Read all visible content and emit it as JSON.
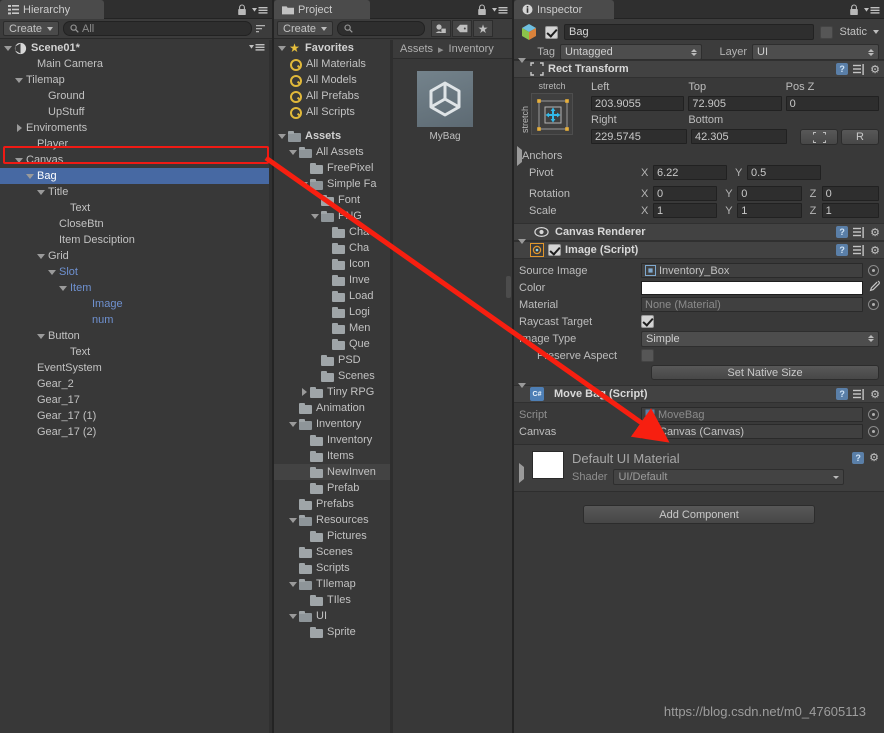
{
  "hierarchy": {
    "tab_label": "Hierarchy",
    "tab_icon": "hierarchy-icon",
    "lock_icon": "lock-icon",
    "menu_icon": "panel-menu-icon",
    "create_label": "Create",
    "search_placeholder": "All",
    "search_value": "All",
    "scene_name": "Scene01*",
    "items": [
      {
        "label": "Main Camera",
        "indent": 2,
        "arrow": "none",
        "style": "normal"
      },
      {
        "label": "Tilemap",
        "indent": 1,
        "arrow": "down",
        "style": "normal"
      },
      {
        "label": "Ground",
        "indent": 3,
        "arrow": "none",
        "style": "normal"
      },
      {
        "label": "UpStuff",
        "indent": 3,
        "arrow": "none",
        "style": "normal"
      },
      {
        "label": "Enviroments",
        "indent": 1,
        "arrow": "right",
        "style": "normal"
      },
      {
        "label": "Player",
        "indent": 2,
        "arrow": "none",
        "style": "normal"
      },
      {
        "label": "Canvas",
        "indent": 1,
        "arrow": "down",
        "style": "normal"
      },
      {
        "label": "Bag",
        "indent": 2,
        "arrow": "down",
        "style": "selected"
      },
      {
        "label": "Title",
        "indent": 3,
        "arrow": "down",
        "style": "normal"
      },
      {
        "label": "Text",
        "indent": 5,
        "arrow": "none",
        "style": "normal"
      },
      {
        "label": "CloseBtn",
        "indent": 4,
        "arrow": "none",
        "style": "normal"
      },
      {
        "label": "Item Desciption",
        "indent": 4,
        "arrow": "none",
        "style": "normal"
      },
      {
        "label": "Grid",
        "indent": 3,
        "arrow": "down",
        "style": "normal"
      },
      {
        "label": "Slot",
        "indent": 4,
        "arrow": "down",
        "style": "blue"
      },
      {
        "label": "Item",
        "indent": 5,
        "arrow": "down",
        "style": "blue"
      },
      {
        "label": "Image",
        "indent": 7,
        "arrow": "none",
        "style": "blue"
      },
      {
        "label": "num",
        "indent": 7,
        "arrow": "none",
        "style": "blue"
      },
      {
        "label": "Button",
        "indent": 3,
        "arrow": "down",
        "style": "normal"
      },
      {
        "label": "Text",
        "indent": 5,
        "arrow": "none",
        "style": "normal"
      },
      {
        "label": "EventSystem",
        "indent": 2,
        "arrow": "none",
        "style": "normal"
      },
      {
        "label": "Gear_2",
        "indent": 2,
        "arrow": "none",
        "style": "normal"
      },
      {
        "label": "Gear_17",
        "indent": 2,
        "arrow": "none",
        "style": "normal"
      },
      {
        "label": "Gear_17 (1)",
        "indent": 2,
        "arrow": "none",
        "style": "normal"
      },
      {
        "label": "Gear_17 (2)",
        "indent": 2,
        "arrow": "none",
        "style": "normal"
      }
    ]
  },
  "project": {
    "tab_label": "Project",
    "tab_icon": "folder-icon",
    "lock_icon": "lock-icon",
    "menu_icon": "panel-menu-icon",
    "create_label": "Create",
    "search_placeholder": "",
    "search_value": "",
    "filter_icons": [
      "object-filter-icon",
      "label-filter-icon",
      "favorite-star-icon"
    ],
    "favorites_label": "Favorites",
    "favorites": [
      {
        "label": "All Materials"
      },
      {
        "label": "All Models"
      },
      {
        "label": "All Prefabs"
      },
      {
        "label": "All Scripts"
      }
    ],
    "assets_label": "Assets",
    "tree": [
      {
        "label": "All Assets",
        "indent": 1,
        "arrow": "down",
        "open": true
      },
      {
        "label": "FreePixel",
        "indent": 2,
        "arrow": "none",
        "open": false
      },
      {
        "label": "Simple Fa",
        "indent": 2,
        "arrow": "down",
        "open": true
      },
      {
        "label": "Font",
        "indent": 3,
        "arrow": "none",
        "open": false
      },
      {
        "label": "PNG",
        "indent": 3,
        "arrow": "down",
        "open": true
      },
      {
        "label": "Cha",
        "indent": 4,
        "arrow": "none",
        "open": false
      },
      {
        "label": "Cha",
        "indent": 4,
        "arrow": "none",
        "open": false
      },
      {
        "label": "Icon",
        "indent": 4,
        "arrow": "none",
        "open": false
      },
      {
        "label": "Inve",
        "indent": 4,
        "arrow": "none",
        "open": false
      },
      {
        "label": "Load",
        "indent": 4,
        "arrow": "none",
        "open": false
      },
      {
        "label": "Logi",
        "indent": 4,
        "arrow": "none",
        "open": false
      },
      {
        "label": "Men",
        "indent": 4,
        "arrow": "none",
        "open": false
      },
      {
        "label": "Que",
        "indent": 4,
        "arrow": "none",
        "open": false
      },
      {
        "label": "PSD",
        "indent": 3,
        "arrow": "none",
        "open": false
      },
      {
        "label": "Scenes",
        "indent": 3,
        "arrow": "none",
        "open": false
      },
      {
        "label": "Tiny RPG",
        "indent": 2,
        "arrow": "right",
        "open": false
      },
      {
        "label": "Animation",
        "indent": 1,
        "arrow": "none",
        "open": false
      },
      {
        "label": "Inventory",
        "indent": 1,
        "arrow": "down",
        "open": true
      },
      {
        "label": "Inventory",
        "indent": 2,
        "arrow": "none",
        "open": false
      },
      {
        "label": "Items",
        "indent": 2,
        "arrow": "none",
        "open": false
      },
      {
        "label": "NewInven",
        "indent": 2,
        "arrow": "none",
        "open": false,
        "style": "softsel"
      },
      {
        "label": "Prefab",
        "indent": 2,
        "arrow": "none",
        "open": false
      },
      {
        "label": "Prefabs",
        "indent": 1,
        "arrow": "none",
        "open": false
      },
      {
        "label": "Resources",
        "indent": 1,
        "arrow": "down",
        "open": true
      },
      {
        "label": "Pictures",
        "indent": 2,
        "arrow": "none",
        "open": false
      },
      {
        "label": "Scenes",
        "indent": 1,
        "arrow": "none",
        "open": false
      },
      {
        "label": "Scripts",
        "indent": 1,
        "arrow": "none",
        "open": false
      },
      {
        "label": "TIlemap",
        "indent": 1,
        "arrow": "down",
        "open": true
      },
      {
        "label": "TIles",
        "indent": 2,
        "arrow": "none",
        "open": false
      },
      {
        "label": "UI",
        "indent": 1,
        "arrow": "down",
        "open": true
      },
      {
        "label": "Sprite",
        "indent": 2,
        "arrow": "none",
        "open": false
      }
    ],
    "breadcrumb": [
      "Assets",
      "Inventory"
    ],
    "assets": [
      {
        "label": "MyBag",
        "icon": "unity-prefab-icon"
      }
    ]
  },
  "inspector": {
    "tab_label": "Inspector",
    "tab_icon": "info-icon",
    "lock_icon": "lock-icon",
    "menu_icon": "panel-menu-icon",
    "object_name": "Bag",
    "object_enabled": true,
    "static_label": "Static",
    "static_checked": false,
    "tag_label": "Tag",
    "tag_value": "Untagged",
    "layer_label": "Layer",
    "layer_value": "UI",
    "rect_transform": {
      "title": "Rect Transform",
      "anchor_preset_top": "stretch",
      "anchor_preset_left": "stretch",
      "left_label": "Left",
      "left_value": "203.9055",
      "top_label": "Top",
      "top_value": "72.905",
      "posz_label": "Pos Z",
      "posz_value": "0",
      "right_label": "Right",
      "right_value": "229.5745",
      "bottom_label": "Bottom",
      "bottom_value": "42.305",
      "blueprint_button": "blueprint-mode-icon",
      "raw_button": "R",
      "anchors_label": "Anchors",
      "pivot_label": "Pivot",
      "pivot_x": "6.22",
      "pivot_y": "0.5",
      "rotation_label": "Rotation",
      "rot_x": "0",
      "rot_y": "0",
      "rot_z": "0",
      "scale_label": "Scale",
      "scale_x": "1",
      "scale_y": "1",
      "scale_z": "1"
    },
    "canvas_renderer": {
      "title": "Canvas Renderer"
    },
    "image_script": {
      "title": "Image (Script)",
      "enabled": true,
      "source_image_label": "Source Image",
      "source_image_value": "Inventory_Box",
      "color_label": "Color",
      "color_value": "#FFFFFF",
      "material_label": "Material",
      "material_value": "None (Material)",
      "raycast_label": "Raycast Target",
      "raycast_checked": true,
      "image_type_label": "Image Type",
      "image_type_value": "Simple",
      "preserve_label": "Preserve Aspect",
      "preserve_checked": false,
      "native_size_button": "Set Native Size"
    },
    "move_bag_script": {
      "title": "Move Bag (Script)",
      "script_label": "Script",
      "script_value": "MoveBag",
      "canvas_label": "Canvas",
      "canvas_value": "Canvas (Canvas)"
    },
    "material": {
      "title": "Default UI Material",
      "shader_label": "Shader",
      "shader_value": "UI/Default"
    },
    "add_component_label": "Add Component"
  },
  "annotations": {
    "watermark": "https://blog.csdn.net/m0_47605113",
    "highlight_color": "#f01a14",
    "arrow_color": "#f71f10"
  }
}
